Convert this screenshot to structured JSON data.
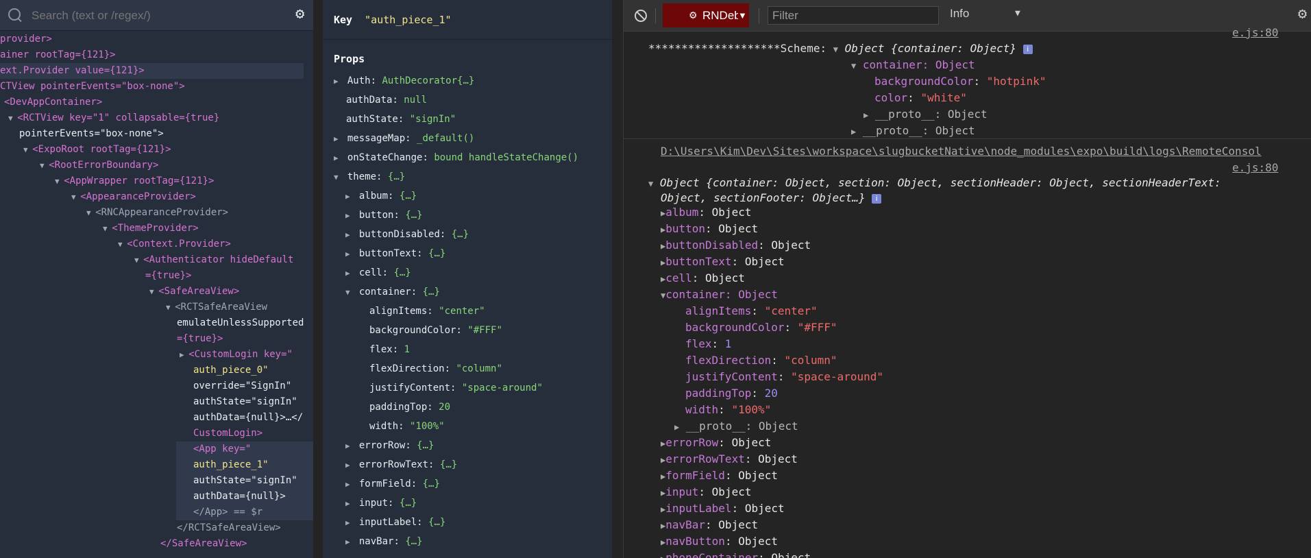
{
  "search": {
    "placeholder": "Search (text or /regex/)"
  },
  "tree": [
    {
      "t": "provider>"
    },
    {
      "t": "ainer rootTag={121}>"
    },
    {
      "t": "ext.Provider value={121}>"
    },
    {
      "t": "CTView pointerEvents=\"box-none\">"
    },
    {
      "t": "<DevAppContainer>"
    },
    {
      "t": "<RCTView key=\"1\" collapsable={true}"
    },
    {
      "t": "pointerEvents=\"box-none\">"
    },
    {
      "t": "<ExpoRoot rootTag={121}>"
    },
    {
      "t": "<RootErrorBoundary>"
    },
    {
      "t": "<AppWrapper rootTag={121}>"
    },
    {
      "t": "<AppearanceProvider>"
    },
    {
      "t": "<RNCAppearanceProvider>"
    },
    {
      "t": "<ThemeProvider>"
    },
    {
      "t": "<Context.Provider>"
    },
    {
      "t": "<Authenticator hideDefault"
    },
    {
      "t": "={true}>"
    },
    {
      "t": "<SafeAreaView>"
    },
    {
      "t": "<RCTSafeAreaView"
    },
    {
      "t": "emulateUnlessSupported"
    },
    {
      "t": "={true}>"
    },
    {
      "t": "<CustomLogin key=\""
    },
    {
      "t": "auth_piece_0\""
    },
    {
      "t": "override=\"SignIn\""
    },
    {
      "t": "authState=\"signIn\""
    },
    {
      "t": "authData={null}>…</"
    },
    {
      "t": "CustomLogin>"
    },
    {
      "t": "<App key=\""
    },
    {
      "t": "auth_piece_1\""
    },
    {
      "t": "authState=\"signIn\""
    },
    {
      "t": "authData={null}>"
    },
    {
      "t": "</App> == $r"
    },
    {
      "t": "</RCTSafeAreaView>"
    },
    {
      "t": "</SafeAreaView>"
    }
  ],
  "keybar": {
    "label": "Key",
    "value": "\"auth_piece_1\""
  },
  "props_title": "Props",
  "props": [
    {
      "k": "Auth",
      "v": "AuthDecorator{…}"
    },
    {
      "k": "authData",
      "v": "null"
    },
    {
      "k": "authState",
      "v": "\"signIn\""
    },
    {
      "k": "messageMap",
      "v": "_default()"
    },
    {
      "k": "onStateChange",
      "v": "bound handleStateChange()"
    },
    {
      "k": "theme",
      "v": "{…}"
    },
    {
      "k": "album",
      "v": "{…}"
    },
    {
      "k": "button",
      "v": "{…}"
    },
    {
      "k": "buttonDisabled",
      "v": "{…}"
    },
    {
      "k": "buttonText",
      "v": "{…}"
    },
    {
      "k": "cell",
      "v": "{…}"
    },
    {
      "k": "container",
      "v": "{…}"
    },
    {
      "k": "alignItems",
      "v": "\"center\""
    },
    {
      "k": "backgroundColor",
      "v": "\"#FFF\""
    },
    {
      "k": "flex",
      "v": "1"
    },
    {
      "k": "flexDirection",
      "v": "\"column\""
    },
    {
      "k": "justifyContent",
      "v": "\"space-around\""
    },
    {
      "k": "paddingTop",
      "v": "20"
    },
    {
      "k": "width",
      "v": "\"100%\""
    },
    {
      "k": "errorRow",
      "v": "{…}"
    },
    {
      "k": "errorRowText",
      "v": "{…}"
    },
    {
      "k": "formField",
      "v": "{…}"
    },
    {
      "k": "input",
      "v": "{…}"
    },
    {
      "k": "inputLabel",
      "v": "{…}"
    },
    {
      "k": "navBar",
      "v": "{…}"
    }
  ],
  "console_bar": {
    "context": "RNDebu",
    "filter_placeholder": "Filter",
    "level": "Info"
  },
  "console": {
    "link1": "e.js:80",
    "scheme_prefix": "********************Scheme:",
    "scheme_summary": "Object {container: Object}",
    "container_line": "container: Object",
    "bg_key": "backgroundColor",
    "bg_val": "\"hotpink\"",
    "color_key": "color",
    "color_val": "\"white\"",
    "proto": "__proto__: Object",
    "path": "D:\\Users\\Kim\\Dev\\Sites\\workspace\\slugbucketNative\\node_modules\\expo\\build\\logs\\RemoteConsol",
    "link2": "e.js:80",
    "obj_summary_1": "Object {container: Object, section: Object, sectionHeader: Object, sectionHeaderText:",
    "obj_summary_2": "Object, sectionFooter: Object…}",
    "items": [
      {
        "k": "album",
        "v": "Object"
      },
      {
        "k": "button",
        "v": "Object"
      },
      {
        "k": "buttonDisabled",
        "v": "Object"
      },
      {
        "k": "buttonText",
        "v": "Object"
      },
      {
        "k": "cell",
        "v": "Object"
      }
    ],
    "container_label": "container: Object",
    "container_props": [
      {
        "k": "alignItems",
        "v": "\"center\"",
        "type": "str"
      },
      {
        "k": "backgroundColor",
        "v": "\"#FFF\"",
        "type": "str"
      },
      {
        "k": "flex",
        "v": "1",
        "type": "num"
      },
      {
        "k": "flexDirection",
        "v": "\"column\"",
        "type": "str"
      },
      {
        "k": "justifyContent",
        "v": "\"space-around\"",
        "type": "str"
      },
      {
        "k": "paddingTop",
        "v": "20",
        "type": "num"
      },
      {
        "k": "width",
        "v": "\"100%\"",
        "type": "str"
      }
    ],
    "items2": [
      {
        "k": "errorRow",
        "v": "Object"
      },
      {
        "k": "errorRowText",
        "v": "Object"
      },
      {
        "k": "formField",
        "v": "Object"
      },
      {
        "k": "input",
        "v": "Object"
      },
      {
        "k": "inputLabel",
        "v": "Object"
      },
      {
        "k": "navBar",
        "v": "Object"
      },
      {
        "k": "navButton",
        "v": "Object"
      },
      {
        "k": "phoneContainer",
        "v": "Object"
      }
    ]
  },
  "colors": {
    "tree_bg": "#262e3b",
    "tag": "#d774d3",
    "value": "#f2e58b",
    "props_value": "#89d67a",
    "console_bg": "#242424",
    "string": "#ef6a6a",
    "number": "#9b8ff5",
    "key": "#c67ad7",
    "context_bg": "#6e0707"
  }
}
